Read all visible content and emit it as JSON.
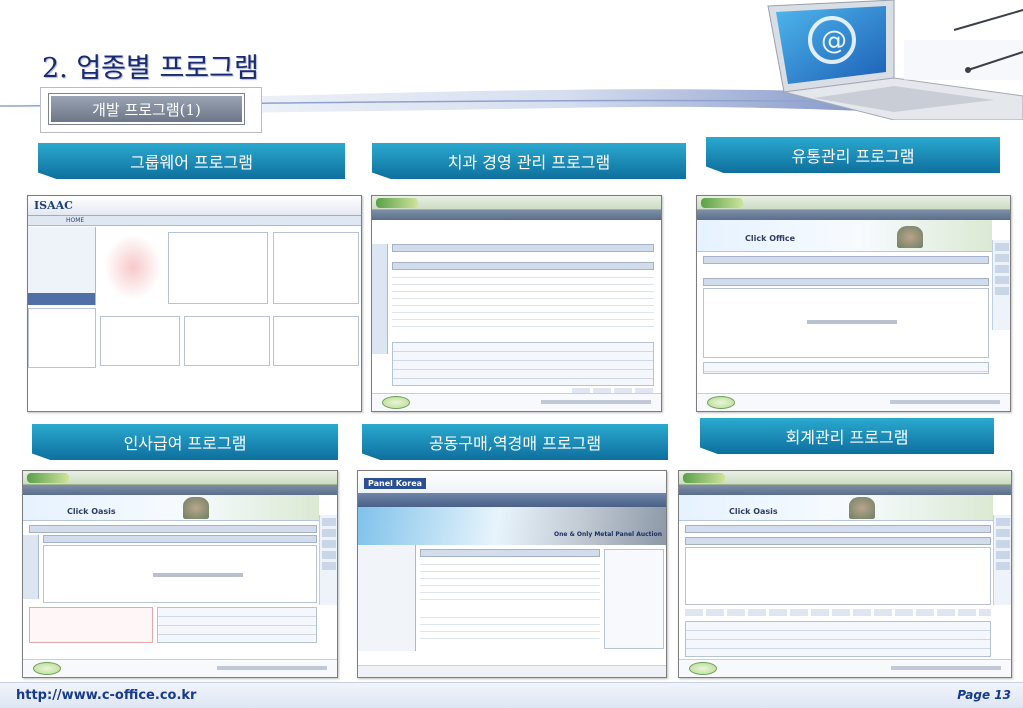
{
  "slide": {
    "title": "2. 업종별 프로그램",
    "subtitle": "개발 프로그램(1)",
    "footer_url": "http://www.c-office.co.kr",
    "page_label": "Page 13",
    "accent_color": "#163a8c",
    "banner_color": "#1a8dbb"
  },
  "panels": [
    {
      "label": "그룹웨어 프로그램",
      "logo_text": "ISAAC",
      "nav_label": "HOME"
    },
    {
      "label": "치과 경영 관리 프로그램",
      "logo_text": "",
      "nav_label": ""
    },
    {
      "label": "유통관리 프로그램",
      "logo_text": "Click Office",
      "nav_label": ""
    },
    {
      "label": "인사급여 프로그램",
      "logo_text": "Click Oasis",
      "nav_label": ""
    },
    {
      "label": "공동구매,역경매 프로그램",
      "logo_text": "Panel Korea",
      "nav_label": "One & Only Metal Panel Auction"
    },
    {
      "label": "회계관리 프로그램",
      "logo_text": "Click Oasis",
      "nav_label": ""
    }
  ]
}
